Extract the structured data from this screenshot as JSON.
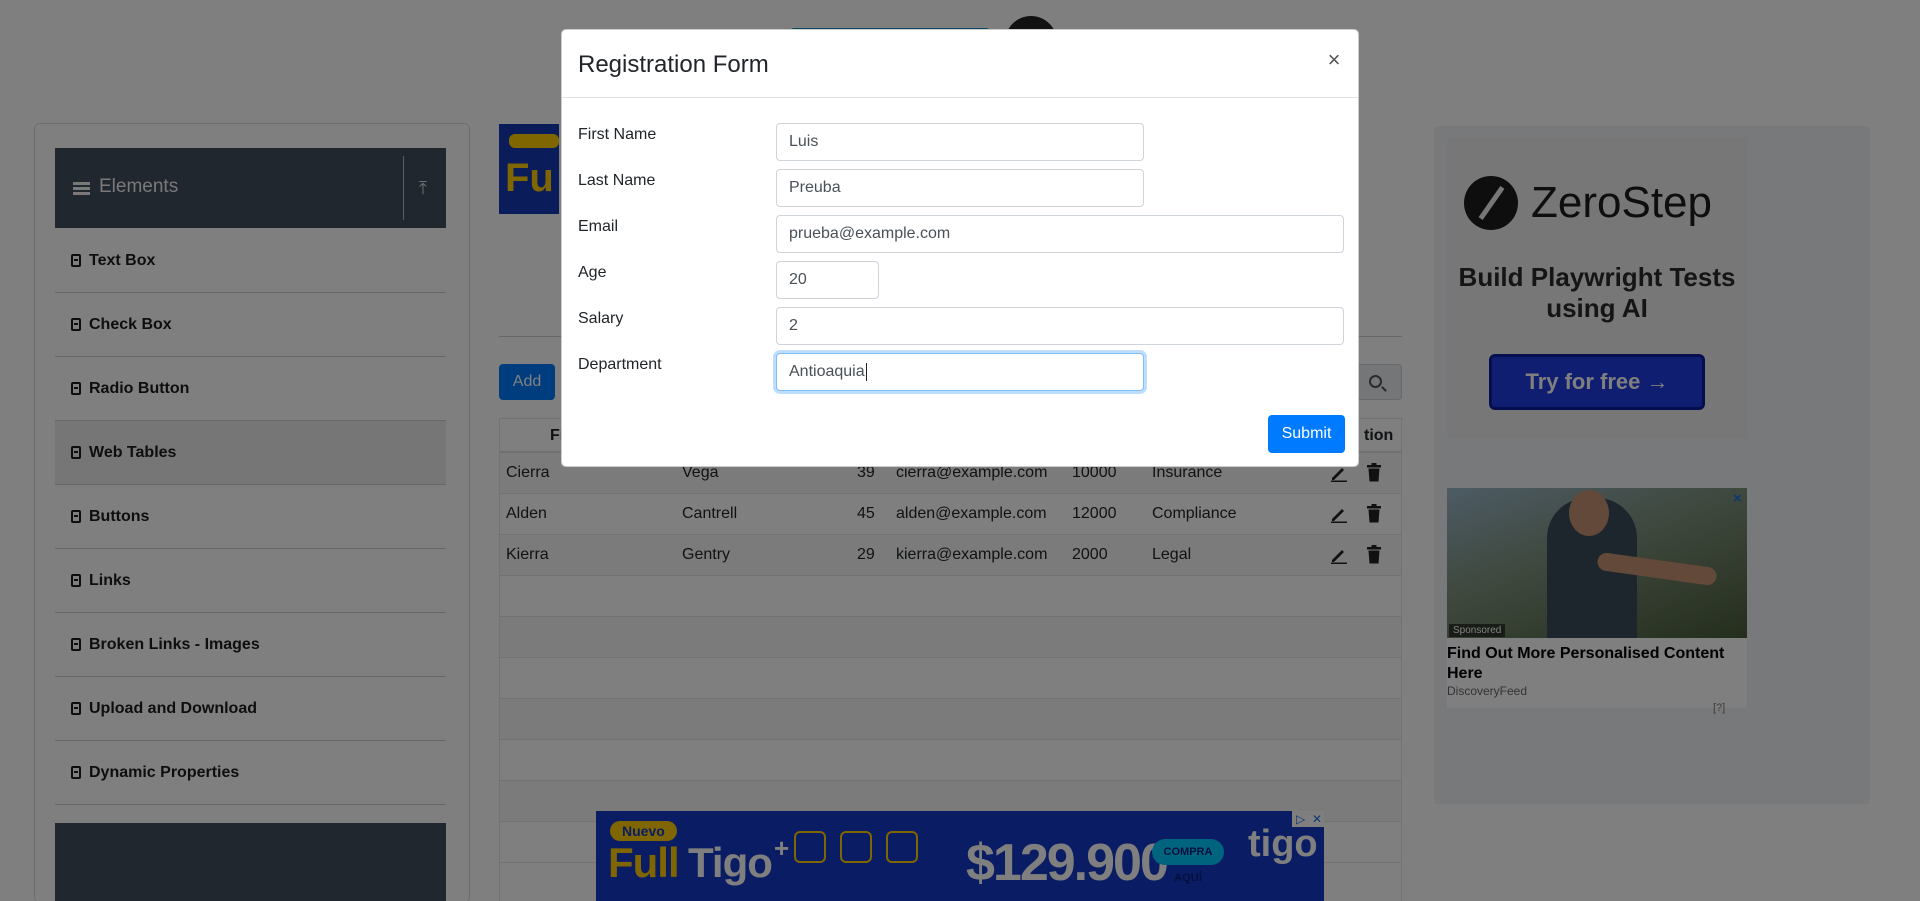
{
  "modal": {
    "title": "Registration Form",
    "close_label": "×",
    "fields": {
      "first_name": {
        "label": "First Name",
        "value": "Luis"
      },
      "last_name": {
        "label": "Last Name",
        "value": "Preuba"
      },
      "email": {
        "label": "Email",
        "value": "prueba@example.com"
      },
      "age": {
        "label": "Age",
        "value": "20"
      },
      "salary": {
        "label": "Salary",
        "value": "2"
      },
      "department": {
        "label": "Department",
        "value": "Antioaquia"
      }
    },
    "submit_label": "Submit"
  },
  "sidebar": {
    "group_title": "Elements",
    "items": [
      {
        "label": "Text Box"
      },
      {
        "label": "Check Box"
      },
      {
        "label": "Radio Button"
      },
      {
        "label": "Web Tables",
        "active": true
      },
      {
        "label": "Buttons"
      },
      {
        "label": "Links"
      },
      {
        "label": "Broken Links - Images"
      },
      {
        "label": "Upload and Download"
      },
      {
        "label": "Dynamic Properties"
      }
    ]
  },
  "table": {
    "add_label": "Add",
    "header_left_fragment": "Fi",
    "header_right_fragment": "tion",
    "rows": [
      {
        "first": "Cierra",
        "last": "Vega",
        "age": "39",
        "email": "cierra@example.com",
        "salary": "10000",
        "department": "Insurance"
      },
      {
        "first": "Alden",
        "last": "Cantrell",
        "age": "45",
        "email": "alden@example.com",
        "salary": "12000",
        "department": "Compliance"
      },
      {
        "first": "Kierra",
        "last": "Gentry",
        "age": "29",
        "email": "kierra@example.com",
        "salary": "2000",
        "department": "Legal"
      }
    ],
    "empty_rows": 7
  },
  "ads": {
    "zerostep": {
      "brand": "ZeroStep",
      "tagline": "Build Playwright Tests using AI",
      "cta": "Try for free →"
    },
    "discovery": {
      "sponsored": "Sponsored",
      "title": "Find Out More Personalised Content Here",
      "source": "DiscoveryFeed",
      "close": "×",
      "adchoice": "[?]"
    },
    "bottom_banner": {
      "badge": "Nuevo",
      "full": "Full",
      "tigo": "Tigo",
      "plus": "+",
      "price": "$129.900",
      "button": "COMPRA AQUÍ",
      "brand": "tigo"
    }
  },
  "colors": {
    "primary": "#007bff",
    "sidebar_header": "#414f5f",
    "overlay": "rgba(0,0,0,0.5)",
    "ad_blue": "#1438c8",
    "ad_yellow": "#ffcc00"
  }
}
